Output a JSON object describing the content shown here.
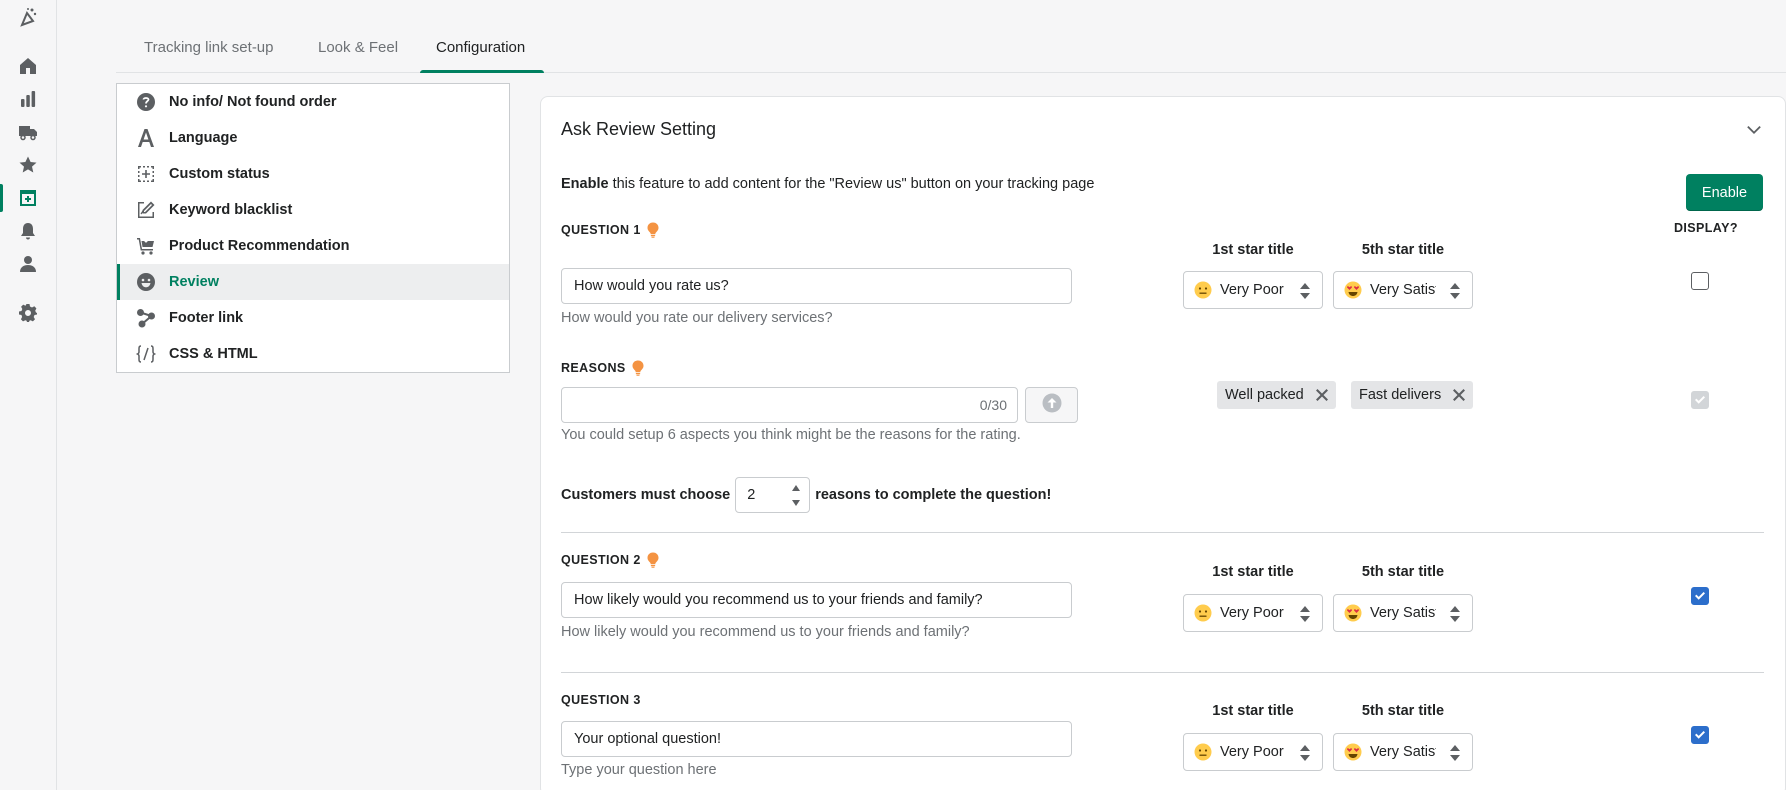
{
  "rail": {
    "items": [
      {
        "name": "logo-icon"
      },
      {
        "name": "home-icon"
      },
      {
        "name": "analytics-icon"
      },
      {
        "name": "shipping-truck-icon"
      },
      {
        "name": "star-icon"
      },
      {
        "name": "tracking-page-icon"
      },
      {
        "name": "notification-bell-icon"
      },
      {
        "name": "customer-icon"
      },
      {
        "name": "settings-gear-icon"
      }
    ]
  },
  "tabs": [
    {
      "label": "Tracking link set-up"
    },
    {
      "label": "Look & Feel"
    },
    {
      "label": "Configuration"
    }
  ],
  "menu": {
    "items": [
      {
        "label": "No info/ Not found order",
        "icon": "question-circle-icon"
      },
      {
        "label": "Language",
        "icon": "language-letter-icon"
      },
      {
        "label": "Custom status",
        "icon": "custom-status-icon"
      },
      {
        "label": "Keyword blacklist",
        "icon": "keyword-blacklist-icon"
      },
      {
        "label": "Product Recommendation",
        "icon": "cart-icon"
      },
      {
        "label": "Review",
        "icon": "smiley-icon"
      },
      {
        "label": "Footer link",
        "icon": "share-nodes-icon"
      },
      {
        "label": "CSS & HTML",
        "icon": "code-icon"
      }
    ],
    "active": "Review"
  },
  "card": {
    "title": "Ask Review Setting",
    "desc_bold": "Enable",
    "desc_rest": " this feature to add content for the \"Review us\" button on your tracking page",
    "enable_label": "Enable",
    "display_header": "DISPLAY?",
    "star_header_1": "1st star title",
    "star_header_5": "5th star title",
    "questions": [
      {
        "label": "QUESTION 1",
        "value": "How would you rate us?",
        "help": "How would you rate our delivery services?",
        "first_star": "Very Poor",
        "fifth_star": "Very Satisfied",
        "display": false
      },
      {
        "label": "QUESTION 2",
        "value": "How likely would you recommend us to your friends and family?",
        "help": "How likely would you recommend us to your friends and family?",
        "first_star": "Very Poor",
        "fifth_star": "Very Satisfied",
        "display": true
      },
      {
        "label": "QUESTION 3",
        "value": "Your optional question!",
        "help": "Type your question here",
        "first_star": "Very Poor",
        "fifth_star": "Very Satisfied",
        "display": true
      }
    ],
    "reasons": {
      "label": "REASONS",
      "value": "",
      "counter": "0/30",
      "help": "You could setup 6 aspects you think might be the reasons for the rating.",
      "tags": [
        "Well packed",
        "Fast delivers"
      ],
      "display": true
    },
    "must_choose": {
      "before": "Customers must choose",
      "value": "2",
      "after": "reasons to complete the question!"
    }
  },
  "colors": {
    "accent": "#008060",
    "checkbox": "#2c6ecb",
    "bulb": "#f49342"
  }
}
